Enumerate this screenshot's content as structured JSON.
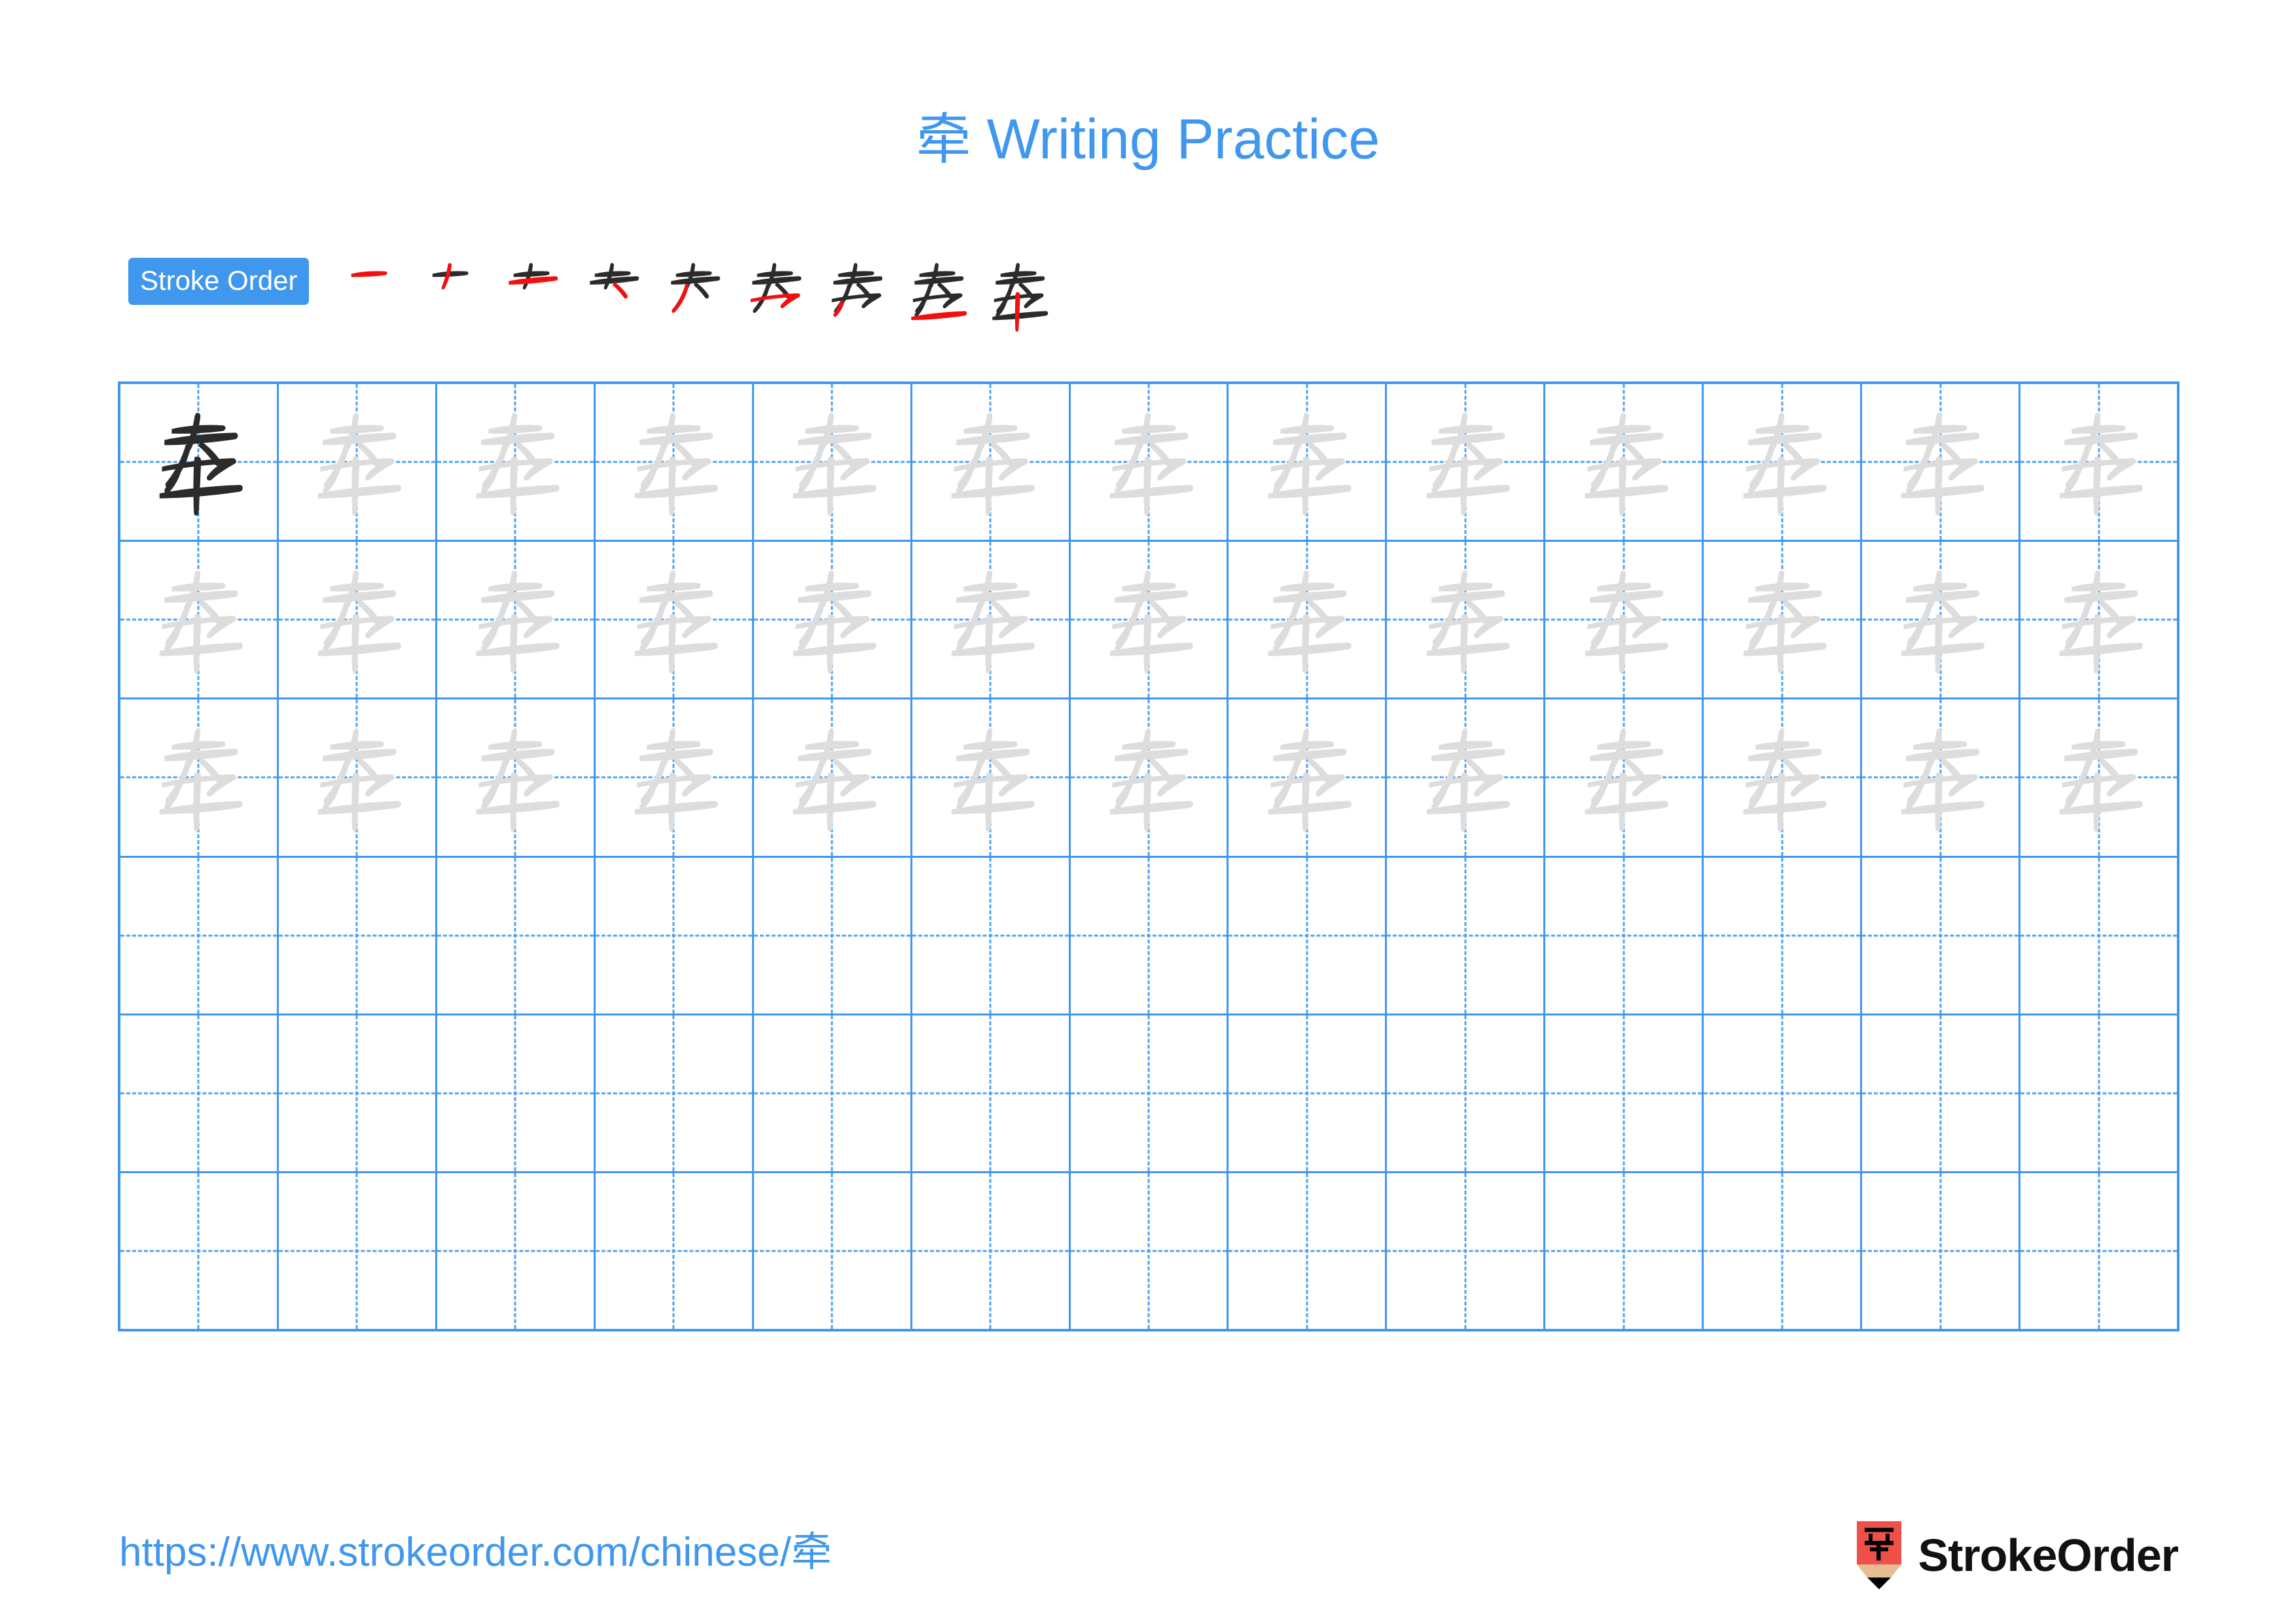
{
  "page": {
    "title_char": "牵",
    "title_suffix": " Writing Practice",
    "accent_blue": "#3f97ee",
    "trace_gray": "#dddddd",
    "ink_black": "#2b2b2b",
    "highlight_red": "#f01010",
    "background": "#ffffff"
  },
  "stroke_order": {
    "label": "Stroke Order",
    "total_strokes": 9,
    "steps": [
      {
        "index": 1,
        "name": "stroke-step-1",
        "new_stroke": "heng"
      },
      {
        "index": 2,
        "name": "stroke-step-2",
        "new_stroke": "pie"
      },
      {
        "index": 3,
        "name": "stroke-step-3",
        "new_stroke": "na"
      },
      {
        "index": 4,
        "name": "stroke-step-4",
        "new_stroke": "pie"
      },
      {
        "index": 5,
        "name": "stroke-step-5",
        "new_stroke": "heng-zhe"
      },
      {
        "index": 6,
        "name": "stroke-step-6",
        "new_stroke": "pie"
      },
      {
        "index": 7,
        "name": "stroke-step-7",
        "new_stroke": "heng"
      },
      {
        "index": 8,
        "name": "stroke-step-8",
        "new_stroke": "heng"
      },
      {
        "index": 9,
        "name": "stroke-step-9",
        "new_stroke": "shu"
      }
    ]
  },
  "practice_grid": {
    "rows": 6,
    "columns": 13,
    "filled_rows": 3,
    "empty_rows": 3,
    "model_cell": {
      "row": 1,
      "column": 1,
      "style": "ink"
    },
    "trace_character": "牵",
    "row_fill": [
      [
        "ink",
        "trace",
        "trace",
        "trace",
        "trace",
        "trace",
        "trace",
        "trace",
        "trace",
        "trace",
        "trace",
        "trace",
        "trace"
      ],
      [
        "trace",
        "trace",
        "trace",
        "trace",
        "trace",
        "trace",
        "trace",
        "trace",
        "trace",
        "trace",
        "trace",
        "trace",
        "trace"
      ],
      [
        "trace",
        "trace",
        "trace",
        "trace",
        "trace",
        "trace",
        "trace",
        "trace",
        "trace",
        "trace",
        "trace",
        "trace",
        "trace"
      ],
      [
        "empty",
        "empty",
        "empty",
        "empty",
        "empty",
        "empty",
        "empty",
        "empty",
        "empty",
        "empty",
        "empty",
        "empty",
        "empty"
      ],
      [
        "empty",
        "empty",
        "empty",
        "empty",
        "empty",
        "empty",
        "empty",
        "empty",
        "empty",
        "empty",
        "empty",
        "empty",
        "empty"
      ],
      [
        "empty",
        "empty",
        "empty",
        "empty",
        "empty",
        "empty",
        "empty",
        "empty",
        "empty",
        "empty",
        "empty",
        "empty",
        "empty"
      ]
    ]
  },
  "footer": {
    "url": "https://www.strokeorder.com/chinese/牵",
    "brand_name": "StrokeOrder",
    "logo_char": "字",
    "logo_body_color": "#f0504a",
    "logo_wood_color": "#e4bd92",
    "logo_tip_color": "#000000"
  }
}
